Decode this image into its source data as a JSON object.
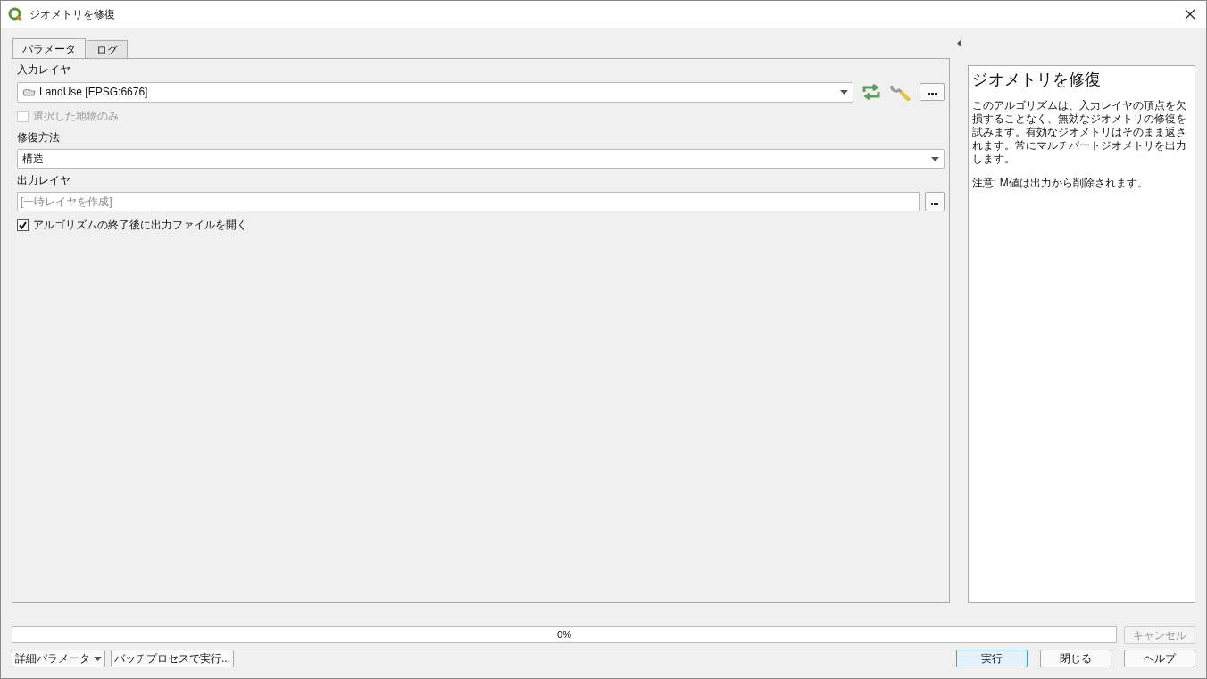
{
  "window": {
    "title": "ジオメトリを修復"
  },
  "tabs": [
    {
      "label": "パラメータ",
      "selected": true
    },
    {
      "label": "ログ",
      "selected": false
    }
  ],
  "parameters": {
    "input_layer": {
      "label": "入力レイヤ",
      "value": "LandUse [EPSG:6676]"
    },
    "selected_only": {
      "label": "選択した地物のみ",
      "checked": false,
      "disabled": true
    },
    "fix_method": {
      "label": "修復方法",
      "value": "構造"
    },
    "output_layer": {
      "label": "出力レイヤ",
      "placeholder": "[一時レイヤを作成]"
    },
    "open_output": {
      "label": "アルゴリズムの終了後に出力ファイルを開く",
      "checked": true
    }
  },
  "help": {
    "title": "ジオメトリを修復",
    "paragraphs": [
      "このアルゴリズムは、入力レイヤの頂点を欠損することなく、無効なジオメトリの修復を試みます。有効なジオメトリはそのまま返されます。常にマルチパートジオメトリを出力します。",
      "注意: M値は出力から削除されます。"
    ]
  },
  "progress": {
    "level": 0,
    "reading": "0%"
  },
  "cancel": {
    "label": "キャンセル",
    "disabled": true
  },
  "left_buttons": [
    {
      "label": "詳細パラメータ",
      "kind": "menu"
    },
    {
      "label": "バッチプロセスで実行...",
      "kind": "plain"
    }
  ],
  "right_buttons": [
    {
      "label": "実行",
      "default": true
    },
    {
      "label": "閉じる",
      "default": false
    },
    {
      "label": "ヘルプ",
      "default": false
    }
  ]
}
